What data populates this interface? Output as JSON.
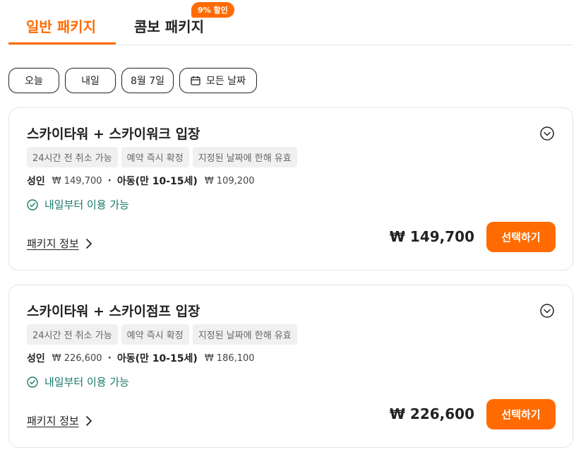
{
  "tabs": {
    "general": "일반 패키지",
    "combo": "콤보 패키지",
    "combo_badge": "9% 할인"
  },
  "date_filters": {
    "today": "오늘",
    "tomorrow": "내일",
    "date": "8월 7일",
    "all": "모든 날짜"
  },
  "packages": [
    {
      "title": "스카이타워 + 스카이워크 입장",
      "tags": [
        "24시간 전 취소 가능",
        "예약 즉시 확정",
        "지정된 날짜에 한해 유효"
      ],
      "adult_label": "성인",
      "adult_price": "₩ 149,700",
      "child_label": "아동(만 10-15세)",
      "child_price": "₩ 109,200",
      "availability": "내일부터 이용 가능",
      "info_link": "패키지 정보",
      "total": "₩ 149,700",
      "select_label": "선택하기"
    },
    {
      "title": "스카이타워 + 스카이점프 입장",
      "tags": [
        "24시간 전 취소 가능",
        "예약 즉시 확정",
        "지정된 날짜에 한해 유효"
      ],
      "adult_label": "성인",
      "adult_price": "₩ 226,600",
      "child_label": "아동(만 10-15세)",
      "child_price": "₩ 186,100",
      "availability": "내일부터 이용 가능",
      "info_link": "패키지 정보",
      "total": "₩ 226,600",
      "select_label": "선택하기"
    }
  ],
  "colors": {
    "accent": "#ff6b00",
    "available": "#1a7a6a"
  },
  "icons": {
    "calendar": "calendar-icon",
    "expand": "chevron-down-circle-icon",
    "check": "check-circle-icon",
    "arrow": "chevron-right-icon"
  }
}
